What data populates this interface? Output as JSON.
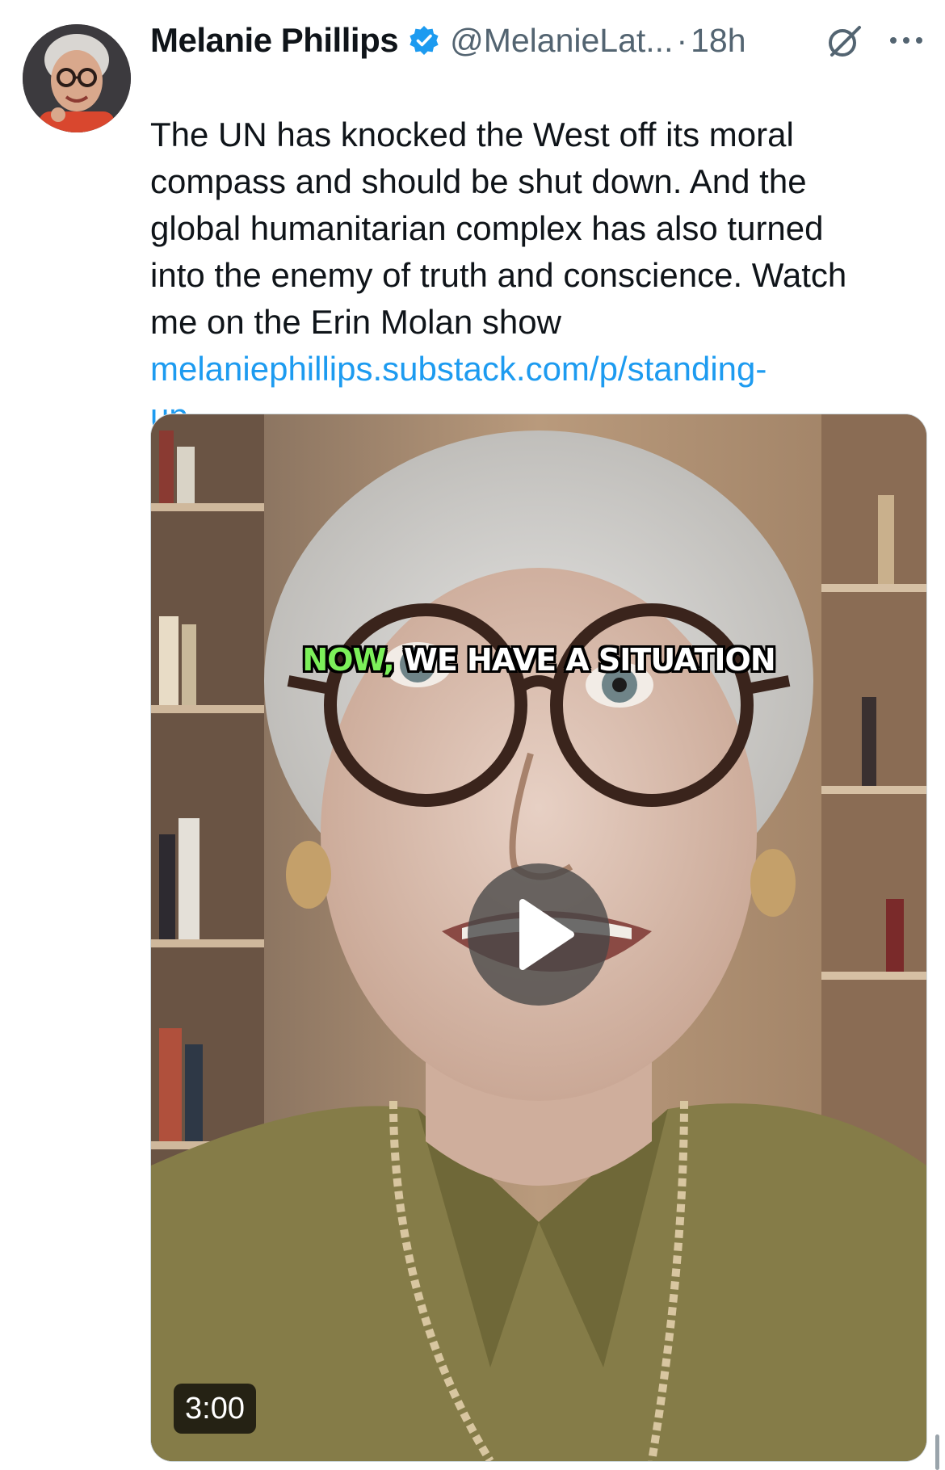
{
  "tweet": {
    "author_name": "Melanie Phillips",
    "handle": "@MelanieLat...",
    "separator": "·",
    "time": "18h",
    "text": "The UN has knocked the West off its moral\ncompass and should be shut down. And the\nglobal humanitarian complex has also turned\ninto the enemy of truth and conscience. Watch\nme on the Erin Molan show",
    "link": "melaniephillips.substack.com/p/standing-\nup-..."
  },
  "media": {
    "caption_highlight": "NOW,",
    "caption_rest": " WE HAVE A SITUATION",
    "duration": "3:00"
  },
  "icons": {
    "verified": "verified-badge-icon",
    "grok": "grok-icon",
    "more": "more-options-icon",
    "play": "play-icon"
  },
  "colors": {
    "link": "#1d9bf0",
    "verified": "#1d9bf0",
    "secondary_text": "#536471",
    "caption_highlight": "#7cf05a"
  }
}
